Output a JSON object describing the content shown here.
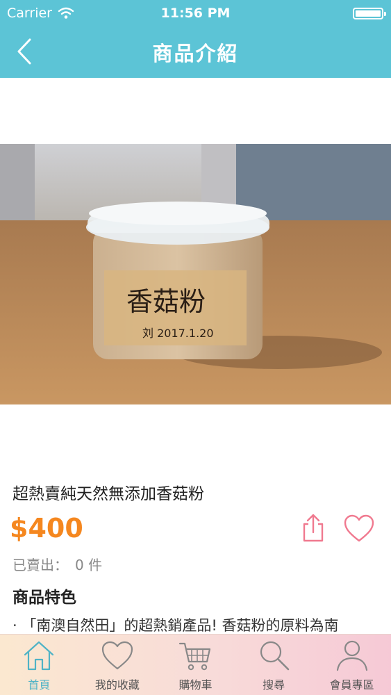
{
  "status_bar": {
    "carrier": "Carrier",
    "time": "11:56 PM"
  },
  "nav": {
    "title": "商品介紹"
  },
  "product": {
    "title": "超熱賣純天然無添加香菇粉",
    "price": "$400",
    "sold_label": "已賣出：",
    "sold_count": "0 件",
    "features_heading": "商品特色",
    "description": "· 「南澳自然田」的超熱銷產品! 香菇粉的原料為南"
  },
  "tabs": [
    {
      "label": "首頁",
      "icon": "home-icon",
      "active": true
    },
    {
      "label": "我的收藏",
      "icon": "heart-icon",
      "active": false
    },
    {
      "label": "購物車",
      "icon": "cart-icon",
      "active": false
    },
    {
      "label": "搜尋",
      "icon": "search-icon",
      "active": false
    },
    {
      "label": "會員專區",
      "icon": "user-icon",
      "active": false
    }
  ],
  "colors": {
    "header": "#5cc4d6",
    "price": "#f5871f",
    "accent_pink": "#f0798f",
    "active_tab": "#4fb3c6"
  }
}
